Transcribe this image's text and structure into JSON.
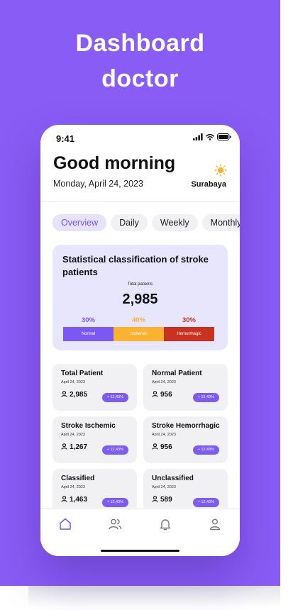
{
  "hero": {
    "line1": "Dashboard",
    "line2": "doctor"
  },
  "status_bar": {
    "time": "9:41"
  },
  "header": {
    "greeting": "Good morning",
    "date": "Monday, April 24, 2023",
    "city": "Surabaya",
    "weather_icon": "sun-icon"
  },
  "tabs": [
    {
      "label": "Overview",
      "active": true
    },
    {
      "label": "Daily",
      "active": false
    },
    {
      "label": "Weekly",
      "active": false
    },
    {
      "label": "Monthly",
      "active": false
    }
  ],
  "stats": {
    "title": "Statistical classification of stroke patients",
    "total_label": "Total patients",
    "total_value": "2,985",
    "segments": [
      {
        "percent": "30%",
        "label": "Normal",
        "color": "#7b57f4"
      },
      {
        "percent": "40%",
        "label": "Ischemic",
        "color": "#fbb230"
      },
      {
        "percent": "30%",
        "label": "Hemorrhagic",
        "color": "#c8321f"
      }
    ]
  },
  "cards": [
    {
      "title": "Total Patient",
      "date": "April 24, 2023",
      "count": "2,985",
      "badge": "+ 12,43%"
    },
    {
      "title": "Normal Patient",
      "date": "April 24, 2023",
      "count": "956",
      "badge": "+ 12,43%"
    },
    {
      "title": "Stroke Ischemic",
      "date": "April 24, 2023",
      "count": "1,267",
      "badge": "+ 12,43%"
    },
    {
      "title": "Stroke Hemorrhagic",
      "date": "April 24, 2023",
      "count": "956",
      "badge": "+ 12,43%"
    },
    {
      "title": "Classified",
      "date": "April 24, 2023",
      "count": "1,463",
      "badge": "+ 12,43%"
    },
    {
      "title": "Unclassified",
      "date": "April 24, 2023",
      "count": "589",
      "badge": "+ 12,43%"
    }
  ],
  "bottom_nav": [
    "home-icon",
    "users-icon",
    "bell-icon",
    "profile-icon"
  ],
  "colors": {
    "brand": "#8a5cf6",
    "accent": "#7c5cf5",
    "active_nav": "#7a52f2"
  }
}
